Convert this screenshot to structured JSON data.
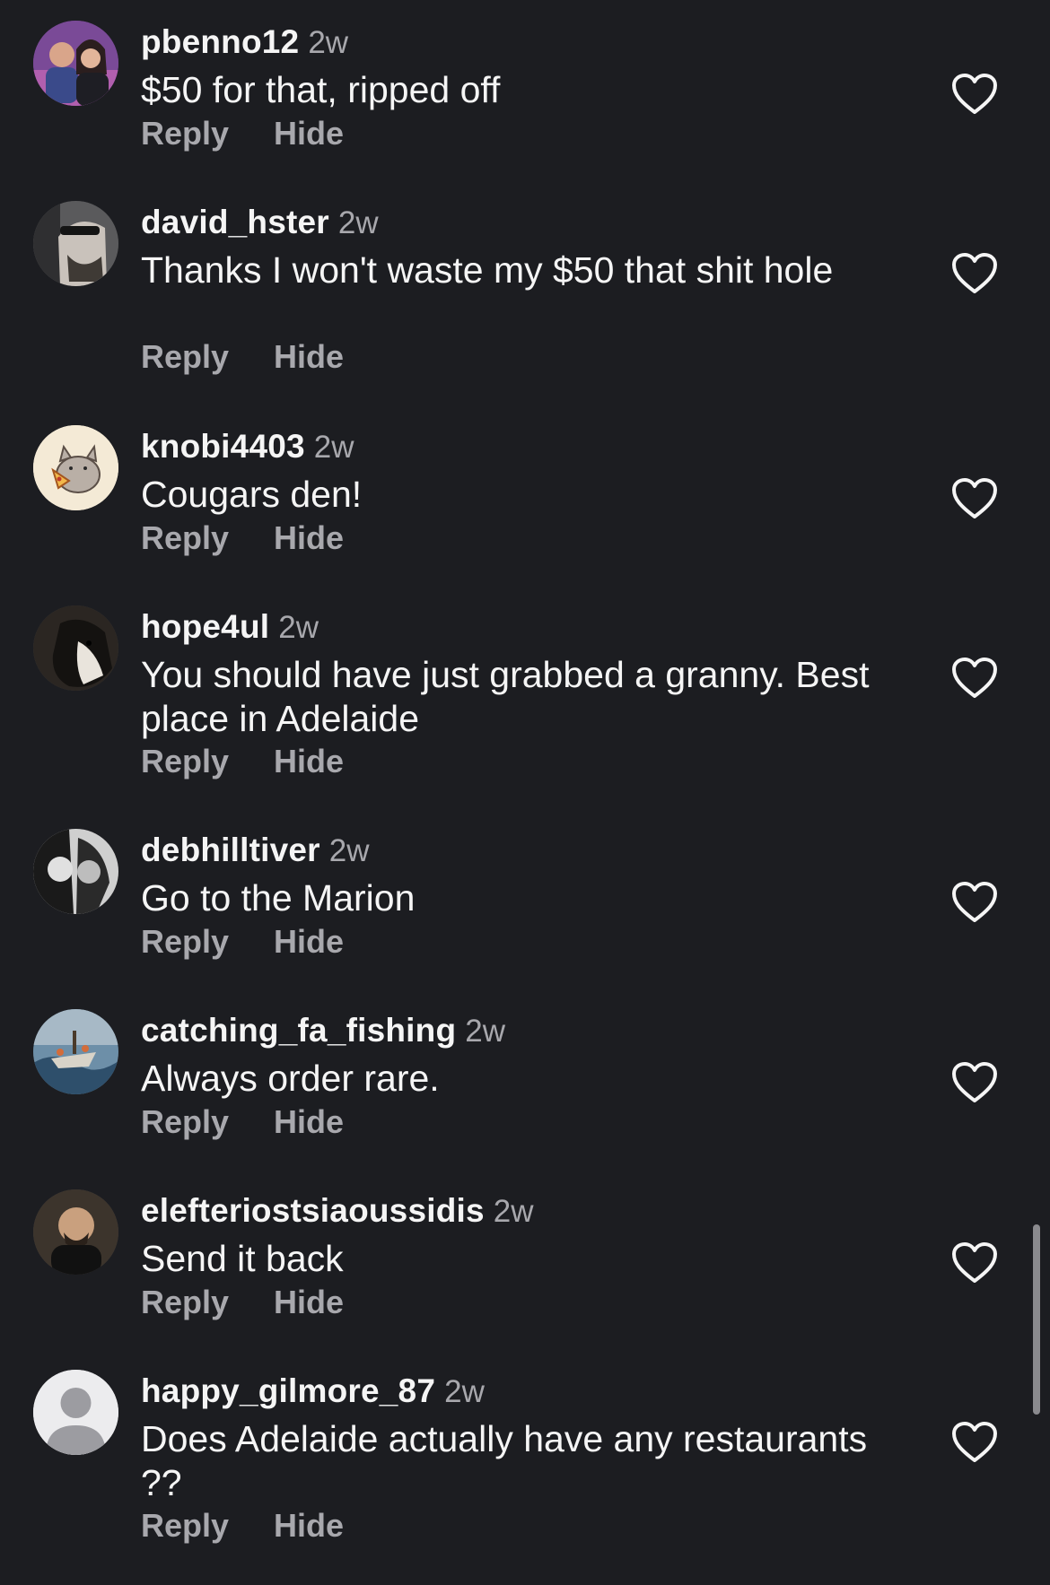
{
  "actions": {
    "reply": "Reply",
    "hide": "Hide"
  },
  "comments": [
    {
      "username": "pbenno12",
      "time": "2w",
      "text": "$50 for that, ripped off",
      "avatar": "couple-photo"
    },
    {
      "username": "david_hster",
      "time": "2w",
      "text": "Thanks I won't waste my $50 that shit hole",
      "avatar": "man-sunglasses-photo"
    },
    {
      "username": "knobi4403",
      "time": "2w",
      "text": "Cougars den!",
      "avatar": "cat-pizza-cartoon"
    },
    {
      "username": "hope4ul",
      "time": "2w",
      "text": "You should have just grabbed a granny. Best place in Adelaide",
      "avatar": "dog-photo"
    },
    {
      "username": "debhilltiver",
      "time": "2w",
      "text": "Go to the Marion",
      "avatar": "bw-couple-photo"
    },
    {
      "username": "catching_fa_fishing",
      "time": "2w",
      "text": "Always order rare.",
      "avatar": "fishing-boat-photo"
    },
    {
      "username": "elefteriostsiaoussidis",
      "time": "2w",
      "text": "Send it back",
      "avatar": "bald-man-photo"
    },
    {
      "username": "happy_gilmore_87",
      "time": "2w",
      "text": "Does Adelaide actually have any restaurants ??",
      "avatar": "default-avatar"
    }
  ],
  "colors": {
    "background": "#1c1d21",
    "text_primary": "#f5f5f5",
    "text_secondary": "#a8a8ad"
  }
}
